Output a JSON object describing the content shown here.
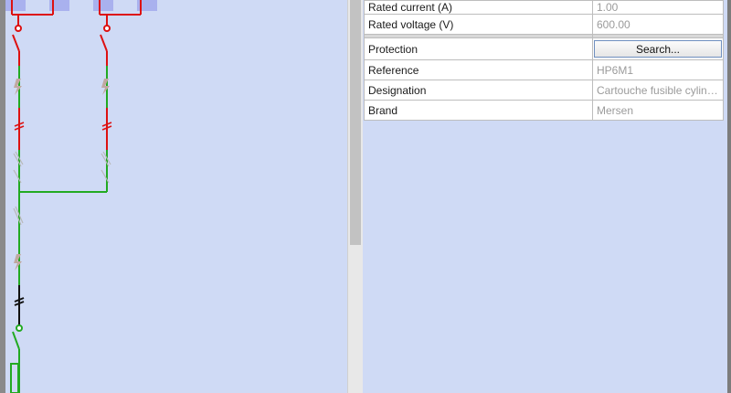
{
  "properties": {
    "rows": [
      {
        "label": "Rated current (A)",
        "value": "1.00"
      },
      {
        "label": "Rated voltage (V)",
        "value": "600.00"
      }
    ],
    "protection": {
      "label": "Protection",
      "button_label": "Search..."
    },
    "rows2": [
      {
        "label": "Reference",
        "value": "HP6M1"
      },
      {
        "label": "Designation",
        "value": "Cartouche fusible cylindriq..."
      },
      {
        "label": "Brand",
        "value": "Mersen"
      }
    ]
  },
  "colors": {
    "wire_red": "#dd1111",
    "wire_green": "#22aa22",
    "wire_black": "#111111",
    "block_blue": "#a9b1ee"
  },
  "icons": {
    "lightning": "lightning-icon",
    "fuse": "fuse-icon",
    "ground": "terminal-icon"
  }
}
